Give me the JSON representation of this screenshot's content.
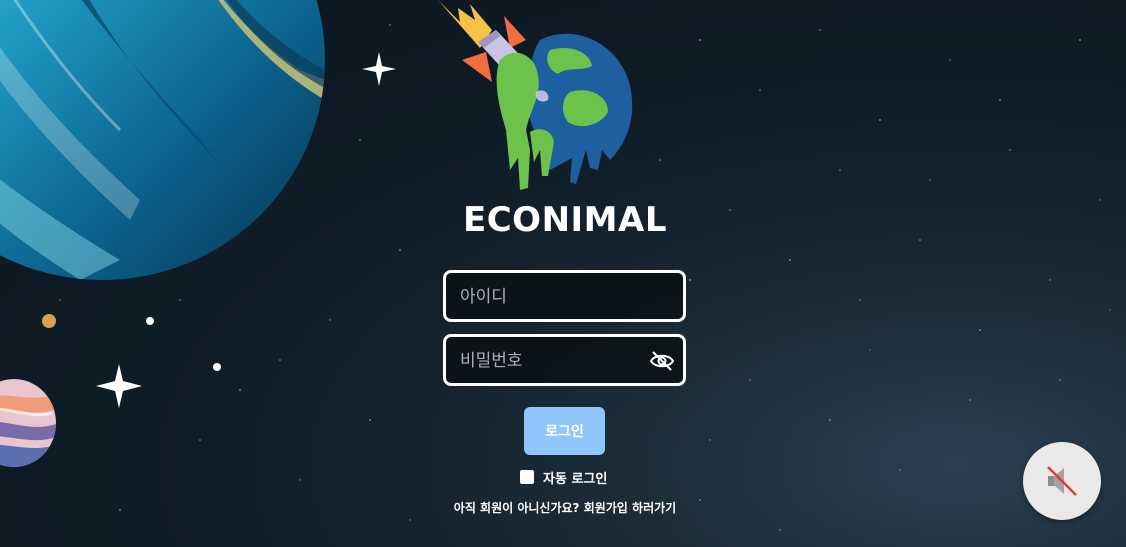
{
  "app": {
    "title": "ECONIMAL"
  },
  "login_form": {
    "id_placeholder": "아이디",
    "id_value": "",
    "password_placeholder": "비밀번호",
    "password_value": "",
    "login_label": "로그인",
    "auto_login_label": "자동 로그인",
    "auto_login_checked": false,
    "signup_prompt": "아직 회원이 아니신가요? 회원가입 하러가기"
  },
  "icons": {
    "password_toggle": "eye-off-icon",
    "sound_toggle": "speaker-muted-icon",
    "logo": "globe-rocket-logo"
  },
  "colors": {
    "background": "#0f1d28",
    "login_button": "#90c6fb",
    "field_border": "#ffffff",
    "mute_slash": "#e53935"
  }
}
